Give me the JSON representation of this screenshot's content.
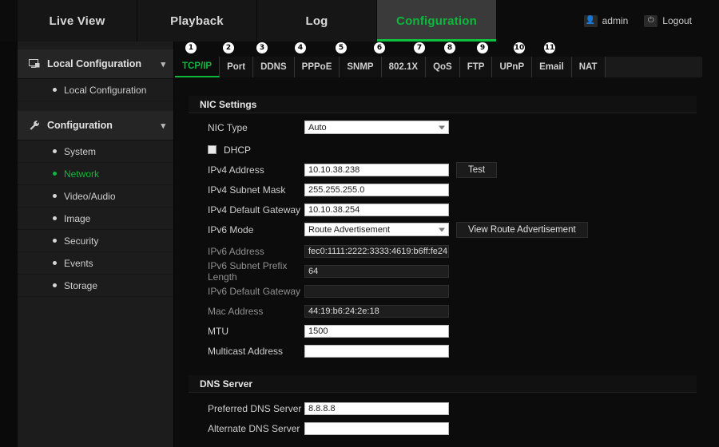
{
  "topnav": {
    "tabs": [
      {
        "label": "Live View",
        "active": false
      },
      {
        "label": "Playback",
        "active": false
      },
      {
        "label": "Log",
        "active": false
      },
      {
        "label": "Configuration",
        "active": true
      }
    ],
    "user": {
      "label": "admin",
      "icon": "user-icon"
    },
    "logout": {
      "label": "Logout",
      "icon": "power-icon"
    },
    "accent_color": "#0db83c"
  },
  "sidebar": {
    "groups": [
      {
        "title": "Local Configuration",
        "icon": "monitor-icon",
        "chevron": "chevron-down-icon",
        "items": [
          {
            "label": "Local Configuration",
            "selected": false
          }
        ]
      },
      {
        "title": "Configuration",
        "icon": "wrench-icon",
        "chevron": "chevron-down-icon",
        "items": [
          {
            "label": "System",
            "selected": false
          },
          {
            "label": "Network",
            "selected": true
          },
          {
            "label": "Video/Audio",
            "selected": false
          },
          {
            "label": "Image",
            "selected": false
          },
          {
            "label": "Security",
            "selected": false
          },
          {
            "label": "Events",
            "selected": false
          },
          {
            "label": "Storage",
            "selected": false
          }
        ]
      }
    ]
  },
  "subtabs": [
    {
      "num": "1",
      "label": "TCP/IP",
      "active": true
    },
    {
      "num": "2",
      "label": "Port",
      "active": false
    },
    {
      "num": "3",
      "label": "DDNS",
      "active": false
    },
    {
      "num": "4",
      "label": "PPPoE",
      "active": false
    },
    {
      "num": "5",
      "label": "SNMP",
      "active": false
    },
    {
      "num": "6",
      "label": "802.1X",
      "active": false
    },
    {
      "num": "7",
      "label": "QoS",
      "active": false
    },
    {
      "num": "8",
      "label": "FTP",
      "active": false
    },
    {
      "num": "9",
      "label": "UPnP",
      "active": false
    },
    {
      "num": "10",
      "label": "Email",
      "active": false
    },
    {
      "num": "11",
      "label": "NAT",
      "active": false
    }
  ],
  "nic": {
    "section_title": "NIC Settings",
    "nic_type": {
      "label": "NIC Type",
      "value": "Auto"
    },
    "dhcp": {
      "label": "DHCP",
      "checked": false
    },
    "ipv4_address": {
      "label": "IPv4 Address",
      "value": "10.10.38.238"
    },
    "test_button": "Test",
    "ipv4_subnet_mask": {
      "label": "IPv4 Subnet Mask",
      "value": "255.255.255.0"
    },
    "ipv4_default_gateway": {
      "label": "IPv4 Default Gateway",
      "value": "10.10.38.254"
    },
    "ipv6_mode": {
      "label": "IPv6 Mode",
      "value": "Route Advertisement"
    },
    "view_route_button": "View Route Advertisement",
    "ipv6_address": {
      "label": "IPv6 Address",
      "value": "fec0:1111:2222:3333:4619:b6ff:fe24:"
    },
    "ipv6_prefix_length": {
      "label": "IPv6 Subnet Prefix Length",
      "value": "64"
    },
    "ipv6_default_gateway": {
      "label": "IPv6 Default Gateway",
      "value": ""
    },
    "mac_address": {
      "label": "Mac Address",
      "value": "44:19:b6:24:2e:18"
    },
    "mtu": {
      "label": "MTU",
      "value": "1500"
    },
    "multicast_address": {
      "label": "Multicast Address",
      "value": ""
    }
  },
  "dns": {
    "section_title": "DNS Server",
    "preferred": {
      "label": "Preferred DNS Server",
      "value": "8.8.8.8"
    },
    "alternate": {
      "label": "Alternate DNS Server",
      "value": ""
    }
  }
}
